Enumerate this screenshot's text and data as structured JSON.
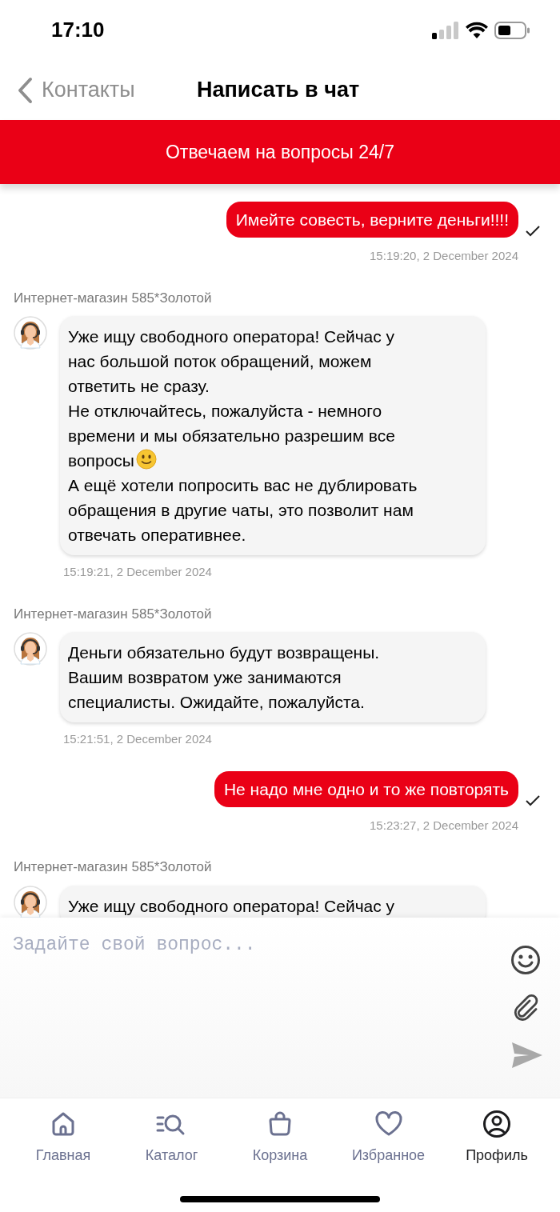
{
  "status_bar": {
    "time": "17:10"
  },
  "nav": {
    "back_label": "Контакты",
    "title": "Написать в чат"
  },
  "banner": "Отвечаем на вопросы 24/7",
  "messages": [
    {
      "kind": "outgoing",
      "paragraphs": [
        {
          "text": "Имейте совесть, верните деньги!!!!",
          "smiley": false
        }
      ],
      "time": "15:19:20, 2 December 2024",
      "delivered": true
    },
    {
      "kind": "incoming",
      "sender": "Интернет-магазин 585*Золотой",
      "paragraphs": [
        {
          "text": "Уже ищу свободного оператора! Сейчас у\nнас большой поток обращений, можем\nответить не сразу.",
          "smiley": false
        },
        {
          "text": "Не отключайтесь, пожалуйста - немного\nвремени и мы обязательно разрешим все\nвопросы",
          "smiley": true
        },
        {
          "text": "А ещё хотели попросить вас не дублировать\nобращения в другие чаты, это позволит нам\nотвечать оперативнее.",
          "smiley": false
        }
      ],
      "time": "15:19:21, 2 December 2024"
    },
    {
      "kind": "incoming",
      "sender": "Интернет-магазин 585*Золотой",
      "paragraphs": [
        {
          "text": "Деньги обязательно будут возвращены.\nВашим возвратом уже занимаются\nспециалисты. Ожидайте, пожалуйста.",
          "smiley": false
        }
      ],
      "time": "15:21:51, 2 December 2024"
    },
    {
      "kind": "outgoing",
      "paragraphs": [
        {
          "text": "Не надо мне одно и то же повторять",
          "smiley": false
        }
      ],
      "time": "15:23:27, 2 December 2024",
      "delivered": true
    },
    {
      "kind": "incoming",
      "sender": "Интернет-магазин 585*Золотой",
      "paragraphs": [
        {
          "text": "Уже ищу свободного оператора! Сейчас у",
          "smiley": false
        }
      ]
    }
  ],
  "composer": {
    "placeholder": "Задайте свой вопрос..."
  },
  "tabs": [
    {
      "label": "Главная",
      "selected": false
    },
    {
      "label": "Каталог",
      "selected": false
    },
    {
      "label": "Корзина",
      "selected": false
    },
    {
      "label": "Избранное",
      "selected": false
    },
    {
      "label": "Профиль",
      "selected": true
    }
  ]
}
